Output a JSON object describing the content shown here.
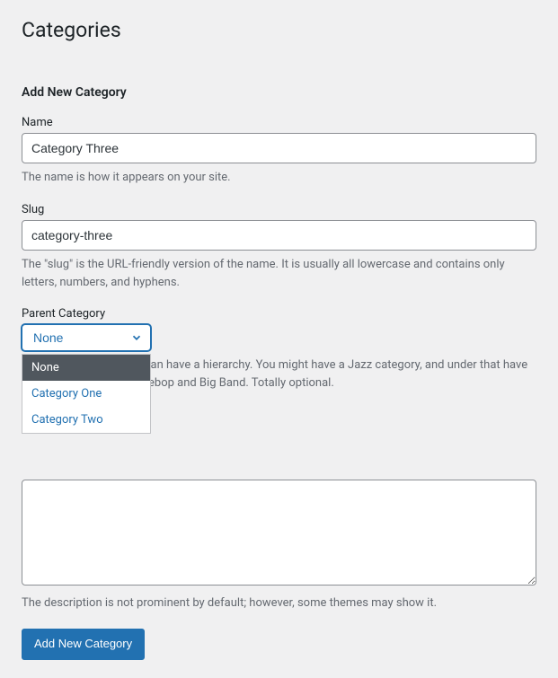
{
  "page": {
    "title": "Categories",
    "section_heading": "Add New Category"
  },
  "name_field": {
    "label": "Name",
    "value": "Category Three",
    "help": "The name is how it appears on your site."
  },
  "slug_field": {
    "label": "Slug",
    "value": "category-three",
    "help": "The \"slug\" is the URL-friendly version of the name. It is usually all lowercase and contains only letters, numbers, and hyphens."
  },
  "parent_field": {
    "label": "Parent Category",
    "selected": "None",
    "options": [
      {
        "label": "None",
        "selected": true
      },
      {
        "label": "Category One",
        "selected": false
      },
      {
        "label": "Category Two",
        "selected": false
      }
    ],
    "help": "Categories, unlike tags, can have a hierarchy. You might have a Jazz category, and under that have children categories for Bebop and Big Band. Totally optional."
  },
  "description_field": {
    "value": "",
    "help": "The description is not prominent by default; however, some themes may show it."
  },
  "submit": {
    "label": "Add New Category"
  }
}
